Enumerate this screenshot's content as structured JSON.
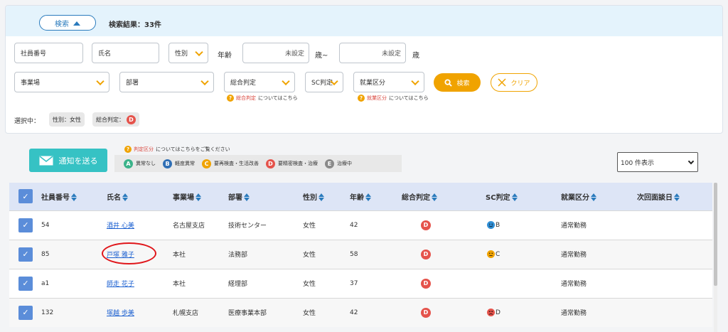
{
  "search_panel": {
    "toggle_label": "検索",
    "result_count": "検索結果：33件",
    "employee_no_placeholder": "社員番号",
    "name_placeholder": "氏名",
    "gender_label": "性別",
    "age_label": "年齢",
    "age_from_value": "未設定",
    "age_from_suffix": "歳~",
    "age_to_value": "未設定",
    "age_to_suffix": "歳",
    "workplace_label": "事業場",
    "department_label": "部署",
    "overall_label": "総合判定",
    "sc_label": "SC判定",
    "work_type_label": "就業区分",
    "overall_note_link": "総合判定",
    "overall_note_text": "についてはこちら",
    "work_note_link": "就業区分",
    "work_note_text": "についてはこちら",
    "search_button": "検索",
    "clear_button": "クリア",
    "selected_label": "選択中：",
    "chip_gender": "性別：女性",
    "chip_overall": "総合判定：",
    "chip_overall_grade": "D"
  },
  "toolbar": {
    "notify_button": "通知を送る",
    "legend_link": "判定区分",
    "legend_text": "についてはこちらをご覧ください",
    "legend_items": [
      {
        "grade": "A",
        "label": "異常なし",
        "color": "#3bb38a"
      },
      {
        "grade": "B",
        "label": "軽度異常",
        "color": "#2f6fb5"
      },
      {
        "grade": "C",
        "label": "要再検査・生活改善",
        "color": "#f0a300"
      },
      {
        "grade": "D",
        "label": "要精密検査・治療",
        "color": "#e5534b"
      },
      {
        "grade": "E",
        "label": "治療中",
        "color": "#8a8a8a"
      }
    ],
    "per_page": "100 件表示"
  },
  "table": {
    "headers": {
      "employee_no": "社員番号",
      "name": "氏名",
      "workplace": "事業場",
      "department": "部署",
      "gender": "性別",
      "age": "年齢",
      "overall": "総合判定",
      "sc": "SC判定",
      "work_type": "就業区分",
      "next_interview": "次回面談日"
    },
    "rows": [
      {
        "employee_no": "54",
        "name": "酒井 心美",
        "workplace": "名古屋支店",
        "department": "技術センター",
        "gender": "女性",
        "age": "42",
        "overall": "D",
        "sc": "B",
        "sc_face": "blue",
        "work_type": "通常勤務"
      },
      {
        "employee_no": "85",
        "name": "戸塚 雅子",
        "workplace": "本社",
        "department": "法務部",
        "gender": "女性",
        "age": "58",
        "overall": "D",
        "sc": "C",
        "sc_face": "orange",
        "work_type": "通常勤務"
      },
      {
        "employee_no": "a1",
        "name": "師走 花子",
        "workplace": "本社",
        "department": "経理部",
        "gender": "女性",
        "age": "37",
        "overall": "D",
        "sc": "",
        "sc_face": "",
        "work_type": "通常勤務"
      },
      {
        "employee_no": "132",
        "name": "塚越 歩美",
        "workplace": "札幌支店",
        "department": "医療事業本部",
        "gender": "女性",
        "age": "42",
        "overall": "D",
        "sc": "D",
        "sc_face": "red",
        "work_type": "通常勤務"
      }
    ]
  },
  "colors": {
    "accent": "#f0a300",
    "notify": "#36c2c4",
    "grade_d": "#e5534b",
    "header_bg": "#dde5f6",
    "checkbox": "#5b8dd9"
  }
}
